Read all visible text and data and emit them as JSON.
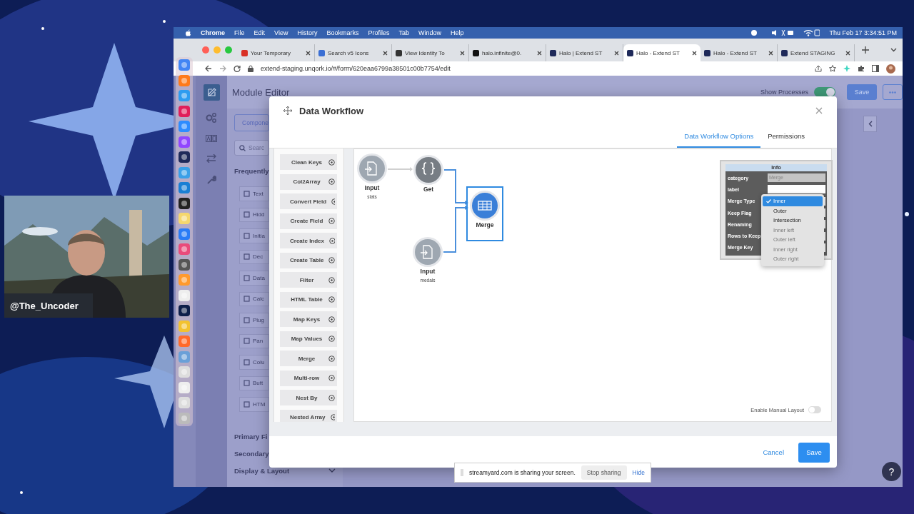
{
  "menu_bar": {
    "app": "Chrome",
    "menus": [
      "File",
      "Edit",
      "View",
      "History",
      "Bookmarks",
      "Profiles",
      "Tab",
      "Window",
      "Help"
    ],
    "clock": "Thu Feb 17  3:34:51 PM"
  },
  "browser": {
    "tabs": [
      {
        "title": "Your Temporary",
        "selected": false,
        "color": "#d93025"
      },
      {
        "title": "Search v5 Icons",
        "selected": false,
        "color": "#3b6fd4"
      },
      {
        "title": "View Identity To",
        "selected": false,
        "color": "#333333"
      },
      {
        "title": "halo.infinite@0.",
        "selected": false,
        "color": "#111111"
      },
      {
        "title": "Halo | Extend ST",
        "selected": false,
        "color": "#1f2a5a"
      },
      {
        "title": "Halo - Extend ST",
        "selected": true,
        "color": "#1f2a5a"
      },
      {
        "title": "Halo - Extend ST",
        "selected": false,
        "color": "#1f2a5a"
      },
      {
        "title": "Extend STAGING",
        "selected": false,
        "color": "#1f2a5a"
      }
    ],
    "url": "extend-staging.unqork.io/#/form/620eaa6799a38501c00b7754/edit"
  },
  "app": {
    "title": "Module Editor",
    "show_processes": {
      "label": "Show Processes",
      "on": true
    },
    "save": "Save",
    "sidebar": {
      "tab": "Compone",
      "search_placeholder": "Searc",
      "section": "Frequently",
      "components": [
        "Text",
        "Hidd",
        "Initia",
        "Dec",
        "Data",
        "Calc",
        "Plug",
        "Pan",
        "Colu",
        "Butt",
        "HTM"
      ],
      "groups": [
        "Primary Fi",
        "Secondary",
        "Display & Layout"
      ]
    },
    "help": "?"
  },
  "modal": {
    "title": "Data Workflow",
    "tabs": [
      {
        "label": "Data Workflow Options",
        "selected": true
      },
      {
        "label": "Permissions",
        "selected": false
      }
    ],
    "operations": [
      "Clean Keys",
      "Col2Array",
      "Convert Field",
      "Create Field",
      "Create Index",
      "Create Table",
      "Filter",
      "HTML Table",
      "Map Keys",
      "Map Values",
      "Merge",
      "Multi-row",
      "Nest By",
      "Nested Array"
    ],
    "nodes": [
      {
        "kind": "input",
        "label": "Input",
        "sublabel": "stats",
        "selected": false
      },
      {
        "kind": "get",
        "label": "Get",
        "selected": false
      },
      {
        "kind": "merge",
        "label": "Merge",
        "selected": true
      },
      {
        "kind": "input",
        "label": "Input",
        "sublabel": "medals",
        "selected": false
      }
    ],
    "info": {
      "title": "Info",
      "fields": [
        {
          "label": "category",
          "value": "Merge",
          "disabled": true
        },
        {
          "label": "label",
          "disabled": false
        },
        {
          "label": "Merge Type",
          "disabled": false
        },
        {
          "label": "Keep Flag",
          "disabled": false
        },
        {
          "label": "Renaming",
          "disabled": false
        },
        {
          "label": "Rows to Keep",
          "disabled": false
        },
        {
          "label": "Merge Key",
          "disabled": false
        }
      ],
      "dropdown": [
        {
          "label": "Inner",
          "selected": true,
          "disabled": false
        },
        {
          "label": "Outer",
          "selected": false,
          "disabled": false
        },
        {
          "label": "Intersection",
          "selected": false,
          "disabled": false
        },
        {
          "label": "Inner left",
          "selected": false,
          "disabled": true
        },
        {
          "label": "Outer left",
          "selected": false,
          "disabled": true
        },
        {
          "label": "Inner right",
          "selected": false,
          "disabled": true
        },
        {
          "label": "Outer right",
          "selected": false,
          "disabled": true
        }
      ]
    },
    "manual_layout": {
      "label": "Enable Manual Layout",
      "on": false
    },
    "cancel": "Cancel",
    "save": "Save"
  },
  "share_bar": {
    "message": "streamyard.com is sharing your screen.",
    "stop": "Stop sharing",
    "hide": "Hide"
  },
  "webcam": {
    "handle": "@The_Uncoder"
  }
}
